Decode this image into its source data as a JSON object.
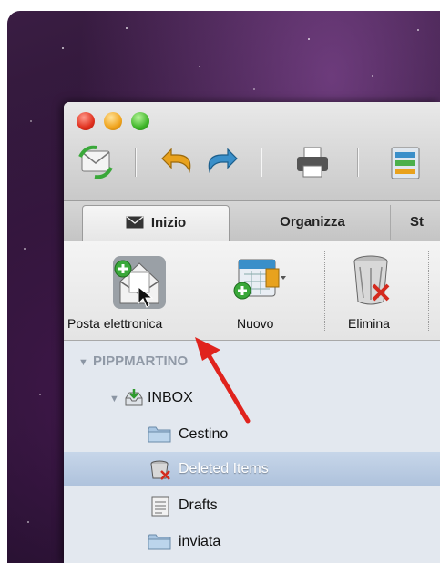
{
  "window": {
    "traffic_lights": [
      "close",
      "minimize",
      "zoom"
    ],
    "toolbar_icons": [
      "send-receive-icon",
      "undo-icon",
      "redo-icon",
      "print-icon",
      "view-icon"
    ]
  },
  "tabs": [
    {
      "label": "Inizio",
      "icon": "envelope-icon",
      "selected": true
    },
    {
      "label": "Organizza",
      "selected": false
    },
    {
      "label": "St",
      "selected": false
    }
  ],
  "ribbon": {
    "buttons": [
      {
        "label": "Posta elettronica",
        "icon": "new-email-icon"
      },
      {
        "label": "Nuovo",
        "icon": "new-items-icon"
      },
      {
        "label": "Elimina",
        "icon": "delete-trash-icon"
      }
    ]
  },
  "folders": {
    "account": "PIPPMARTINO",
    "inbox": "INBOX",
    "items": [
      {
        "label": "Cestino",
        "icon": "folder-icon",
        "selected": false
      },
      {
        "label": "Deleted Items",
        "icon": "trash-folder-icon",
        "selected": true
      },
      {
        "label": "Drafts",
        "icon": "drafts-icon",
        "selected": false
      },
      {
        "label": "inviata",
        "icon": "folder-icon",
        "selected": false
      }
    ]
  },
  "colors": {
    "selection": "#aec2dc",
    "pane": "#e3e8ef",
    "arrow": "#e0231d"
  }
}
